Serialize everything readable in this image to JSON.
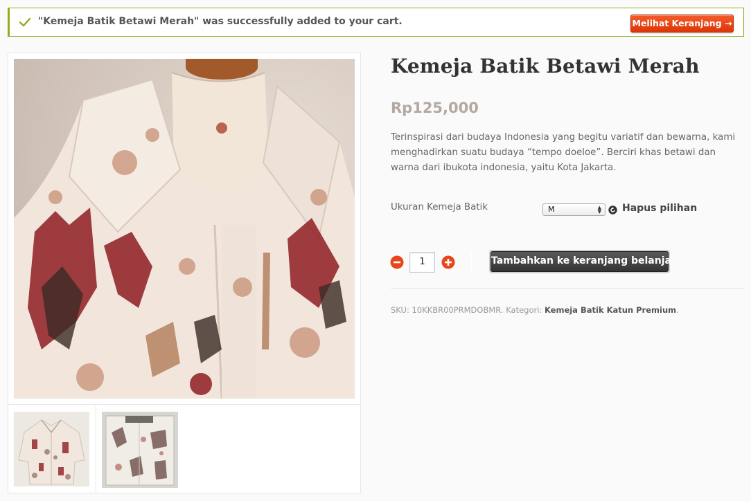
{
  "notice": {
    "message": "\"Kemeja Batik Betawi Merah\" was successfully added to your cart.",
    "view_cart_label": "Melihat Keranjang →",
    "accent_color": "#8fae1b"
  },
  "product": {
    "title": "Kemeja Batik Betawi Merah",
    "price": "Rp125,000",
    "description": "Terinspirasi dari budaya Indonesia yang begitu variatif dan bewarna, kami menghadirkan suatu budaya “tempo doeloe”. Berciri khas betawi dan warna dari ibukota indonesia, yaitu Kota Jakarta.",
    "variation_label": "Ukuran Kemeja Batik",
    "variation_selected": "M",
    "reset_label": "Hapus pilihan",
    "quantity": "1",
    "add_to_cart_label": "Tambahkan ke keranjang belanja",
    "sku_label": "SKU:",
    "sku": "10KKBR00PRMDOBMR",
    "category_label": "Kategori:",
    "category": "Kemeja Batik Katun Premium",
    "category_suffix": "."
  },
  "gallery": {
    "main_image": "batik-shirt-on-mannequin",
    "thumbnails": [
      "shirt-front-thumbnail",
      "folded-shirt-thumbnail"
    ]
  },
  "colors": {
    "button_orange": "#e8461a",
    "title": "#333333",
    "price": "#b4a9a2"
  }
}
